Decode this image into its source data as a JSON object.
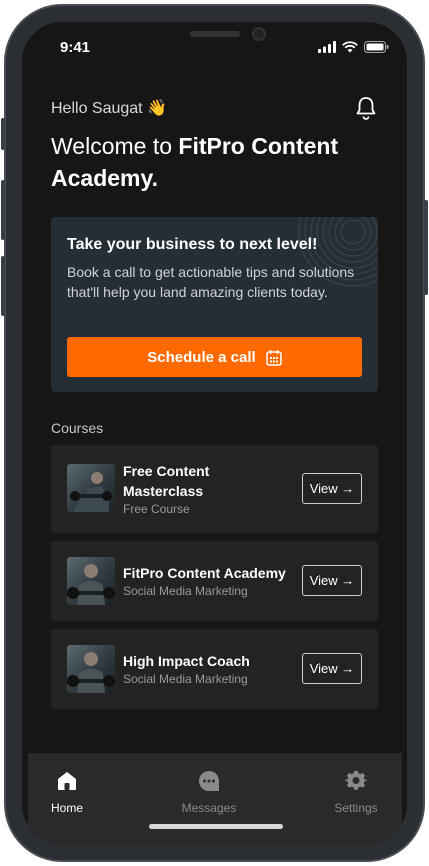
{
  "status": {
    "time": "9:41"
  },
  "header": {
    "greeting": "Hello Saugat 👋",
    "welcome_prefix": "Welcome to ",
    "welcome_brand": "FitPro Content Academy."
  },
  "promo": {
    "title": "Take your business to next level!",
    "text": "Book a call to get actionable tips and solutions that'll help you land amazing clients today.",
    "cta_label": "Schedule a call"
  },
  "courses": {
    "section_title": "Courses",
    "items": [
      {
        "title": "Free Content Masterclass",
        "subtitle": "Free Course",
        "view_label": "View →"
      },
      {
        "title": "FitPro Content Academy",
        "subtitle": "Social Media Marketing",
        "view_label": "View →"
      },
      {
        "title": "High Impact Coach",
        "subtitle": "Social Media Marketing",
        "view_label": "View →"
      }
    ]
  },
  "tabs": [
    {
      "label": "Home",
      "icon": "home-icon",
      "active": true
    },
    {
      "label": "Messages",
      "icon": "chat-icon",
      "active": false
    },
    {
      "label": "Settings",
      "icon": "gear-icon",
      "active": false
    }
  ],
  "colors": {
    "accent": "#ff6a00",
    "background": "#161616",
    "card": "#232323",
    "promo_card": "#252d35"
  }
}
